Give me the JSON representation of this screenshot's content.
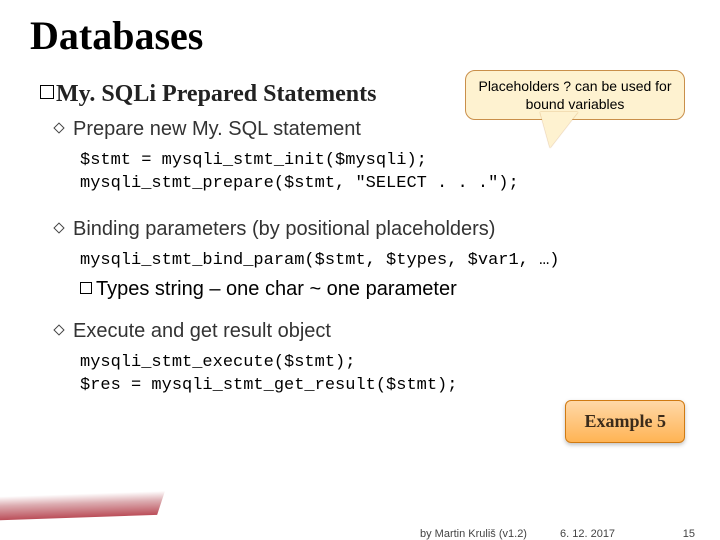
{
  "title": "Databases",
  "heading_prefix": "My. SQLi",
  "heading_rest": " Prepared Statements",
  "callout": "Placeholders ? can be used for bound variables",
  "sub1": "Prepare new My. SQL statement",
  "code1": "$stmt = mysqli_stmt_init($mysqli);\nmysqli_stmt_prepare($stmt, \"SELECT . . .\");",
  "sub2": "Binding parameters (by positional placeholders)",
  "code2": "mysqli_stmt_bind_param($stmt, $types, $var1, …)",
  "types_line": "Types string – one char ~ one parameter",
  "sub3": "Execute and get result object",
  "code3": "mysqli_stmt_execute($stmt);\n$res = mysqli_stmt_get_result($stmt);",
  "example_label": "Example 5",
  "footer": {
    "author": "by Martin Kruliš (v1.2)",
    "date": "6. 12. 2017",
    "page": "15"
  }
}
